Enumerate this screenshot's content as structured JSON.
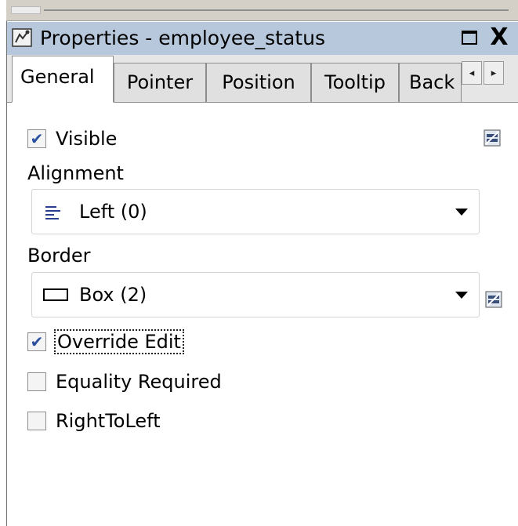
{
  "window": {
    "title": "Properties - employee_status",
    "restore_label": "",
    "close_label": "X"
  },
  "tabs": [
    {
      "label": "General",
      "active": true
    },
    {
      "label": "Pointer",
      "active": false
    },
    {
      "label": "Position",
      "active": false
    },
    {
      "label": "Tooltip",
      "active": false
    },
    {
      "label": "Back",
      "active": false
    }
  ],
  "tab_scroll": {
    "left": "◂",
    "right": "▸"
  },
  "general": {
    "visible": {
      "label": "Visible",
      "checked": true
    },
    "alignment": {
      "label": "Alignment",
      "value": "Left (0)",
      "icon": "align-left-icon"
    },
    "border": {
      "label": "Border",
      "value": "Box (2)",
      "icon": "box-border-icon"
    },
    "override_edit": {
      "label": "Override Edit",
      "checked": true
    },
    "equality_required": {
      "label": "Equality Required",
      "checked": false
    },
    "right_to_left": {
      "label": "RightToLeft",
      "checked": false
    }
  },
  "colors": {
    "titlebar": "#b7c8dc",
    "check": "#2a4f9e"
  }
}
